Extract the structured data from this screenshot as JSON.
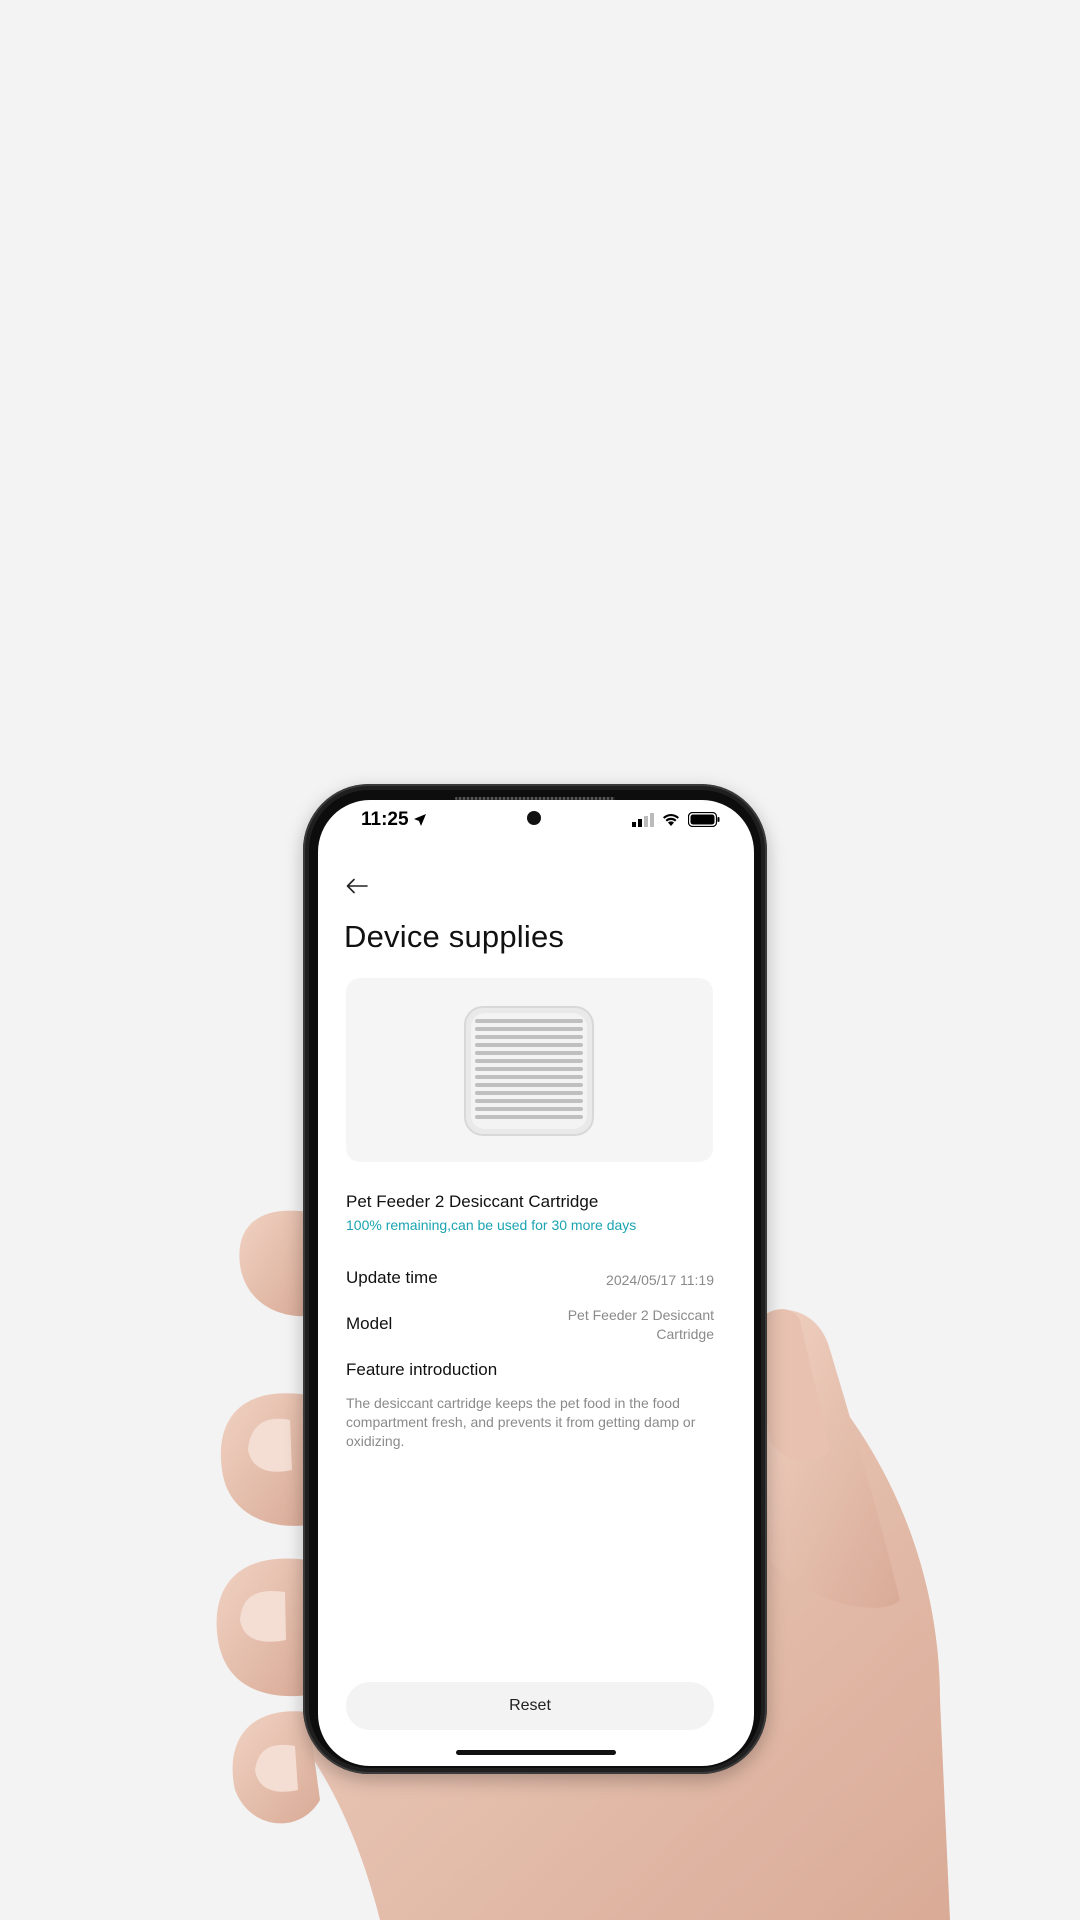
{
  "status_bar": {
    "time": "11:25",
    "location_icon": "location-arrow-icon",
    "signal_icon": "cellular-signal-icon",
    "wifi_icon": "wifi-icon",
    "battery_icon": "battery-icon"
  },
  "header": {
    "back_icon": "back-arrow-icon",
    "title": "Device supplies"
  },
  "product": {
    "image": "desiccant-cartridge-image",
    "name": "Pet Feeder 2 Desiccant Cartridge",
    "status": "100% remaining,can be used for 30 more days",
    "remaining_percent": 100
  },
  "details": {
    "update_time_label": "Update time",
    "update_time_value": "2024/05/17 11:19",
    "model_label": "Model",
    "model_value_line1": "Pet Feeder 2 Desiccant",
    "model_value_line2": "Cartridge",
    "feature_label": "Feature introduction",
    "feature_text": "The desiccant cartridge keeps the pet food in the food compartment fresh, and prevents it from getting damp or oxidizing."
  },
  "actions": {
    "reset_label": "Reset"
  },
  "colors": {
    "accent": "#1aa4b0",
    "background": "#f3f3f3",
    "screen": "#ffffff"
  }
}
